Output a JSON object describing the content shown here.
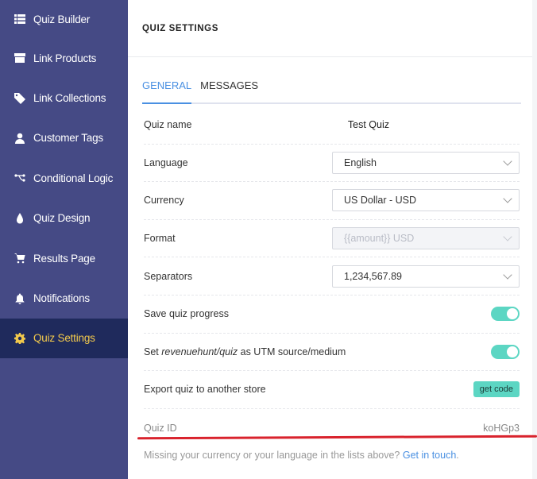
{
  "sidebar": {
    "items": [
      {
        "label": "Quiz Builder",
        "icon": "list-icon"
      },
      {
        "label": "Link Products",
        "icon": "box-icon"
      },
      {
        "label": "Link Collections",
        "icon": "tag-icon"
      },
      {
        "label": "Customer Tags",
        "icon": "user-icon"
      },
      {
        "label": "Conditional Logic",
        "icon": "branch-icon"
      },
      {
        "label": "Quiz Design",
        "icon": "drop-icon"
      },
      {
        "label": "Results Page",
        "icon": "cart-icon"
      },
      {
        "label": "Notifications",
        "icon": "bell-icon"
      },
      {
        "label": "Quiz Settings",
        "icon": "gear-icon",
        "active": true
      }
    ]
  },
  "header": {
    "title": "QUIZ SETTINGS"
  },
  "tabs": [
    {
      "label": "GENERAL",
      "active": true
    },
    {
      "label": "MESSAGES",
      "active": false
    }
  ],
  "settings": {
    "quiz_name": {
      "label": "Quiz name",
      "value": "Test Quiz"
    },
    "language": {
      "label": "Language",
      "value": "English"
    },
    "currency": {
      "label": "Currency",
      "value": "US Dollar - USD"
    },
    "format": {
      "label": "Format",
      "value": "{{amount}} USD"
    },
    "separators": {
      "label": "Separators",
      "value": "1,234,567.89"
    },
    "save_progress": {
      "label": "Save quiz progress",
      "enabled": true
    },
    "utm": {
      "label_prefix": "Set ",
      "label_em": "revenuehunt/quiz",
      "label_suffix": " as UTM source/medium",
      "enabled": true
    },
    "export": {
      "label": "Export quiz to another store",
      "button": "get code"
    },
    "quiz_id": {
      "label": "Quiz ID",
      "value": "koHGp3"
    }
  },
  "footer": {
    "text": "Missing your currency or your language in the lists above? ",
    "link": "Get in touch",
    "tail": "."
  },
  "colors": {
    "sidebar_bg": "#454a85",
    "sidebar_active_bg": "#1f2a5c",
    "active_text": "#f2c94c",
    "accent": "#4a90e2",
    "toggle": "#5cd6c3",
    "highlight_line": "#d9232d"
  }
}
